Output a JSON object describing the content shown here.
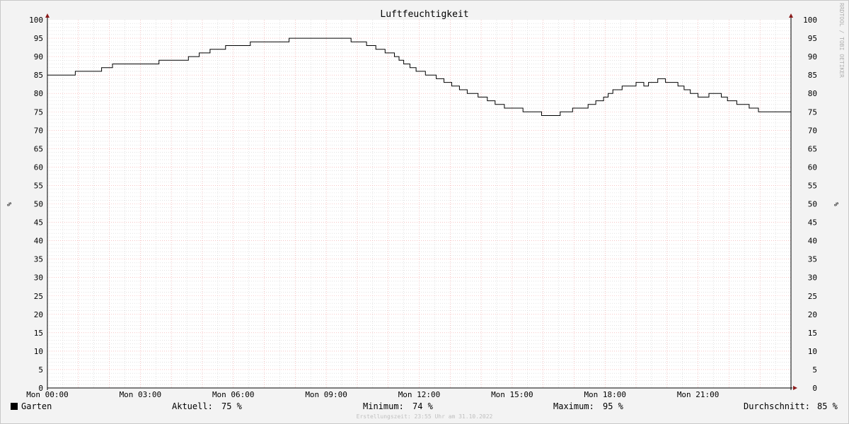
{
  "chart_data": {
    "type": "line",
    "title": "Luftfeuchtigkeit",
    "ylabel": "%",
    "ylim": [
      0,
      100
    ],
    "yticks": [
      0,
      5,
      10,
      15,
      20,
      25,
      30,
      35,
      40,
      45,
      50,
      55,
      60,
      65,
      70,
      75,
      80,
      85,
      90,
      95,
      100
    ],
    "xlim_hours": [
      0,
      24
    ],
    "xticks": [
      {
        "hour": 0,
        "label": "Mon 00:00"
      },
      {
        "hour": 3,
        "label": "Mon 03:00"
      },
      {
        "hour": 6,
        "label": "Mon 06:00"
      },
      {
        "hour": 9,
        "label": "Mon 09:00"
      },
      {
        "hour": 12,
        "label": "Mon 12:00"
      },
      {
        "hour": 15,
        "label": "Mon 15:00"
      },
      {
        "hour": 18,
        "label": "Mon 18:00"
      },
      {
        "hour": 21,
        "label": "Mon 21:00"
      }
    ],
    "grid": true,
    "series": [
      {
        "name": "Garten",
        "color": "#000000",
        "step": true,
        "points": [
          [
            0.0,
            85
          ],
          [
            0.9,
            86
          ],
          [
            1.75,
            87
          ],
          [
            2.1,
            88
          ],
          [
            3.6,
            89
          ],
          [
            4.55,
            90
          ],
          [
            4.9,
            91
          ],
          [
            5.25,
            92
          ],
          [
            5.75,
            93
          ],
          [
            6.55,
            94
          ],
          [
            7.8,
            95
          ],
          [
            9.8,
            94
          ],
          [
            10.3,
            93
          ],
          [
            10.6,
            92
          ],
          [
            10.9,
            91
          ],
          [
            11.2,
            90
          ],
          [
            11.35,
            89
          ],
          [
            11.5,
            88
          ],
          [
            11.7,
            87
          ],
          [
            11.9,
            86
          ],
          [
            12.2,
            85
          ],
          [
            12.55,
            84
          ],
          [
            12.8,
            83
          ],
          [
            13.05,
            82
          ],
          [
            13.3,
            81
          ],
          [
            13.55,
            80
          ],
          [
            13.9,
            79
          ],
          [
            14.2,
            78
          ],
          [
            14.45,
            77
          ],
          [
            14.75,
            76
          ],
          [
            15.35,
            75
          ],
          [
            15.95,
            74
          ],
          [
            16.55,
            75
          ],
          [
            16.95,
            76
          ],
          [
            17.45,
            77
          ],
          [
            17.7,
            78
          ],
          [
            17.95,
            79
          ],
          [
            18.1,
            80
          ],
          [
            18.25,
            81
          ],
          [
            18.55,
            82
          ],
          [
            19.0,
            83
          ],
          [
            19.25,
            82
          ],
          [
            19.4,
            83
          ],
          [
            19.7,
            84
          ],
          [
            19.95,
            83
          ],
          [
            20.35,
            82
          ],
          [
            20.55,
            81
          ],
          [
            20.75,
            80
          ],
          [
            21.0,
            79
          ],
          [
            21.35,
            80
          ],
          [
            21.75,
            79
          ],
          [
            21.95,
            78
          ],
          [
            22.25,
            77
          ],
          [
            22.65,
            76
          ],
          [
            22.95,
            75
          ],
          [
            24.0,
            75
          ]
        ]
      }
    ]
  },
  "legend": {
    "series_name": "Garten",
    "current_label": "Aktuell:",
    "current_value": "75 %",
    "min_label": "Minimum:",
    "min_value": "74 %",
    "max_label": "Maximum:",
    "max_value": "95 %",
    "avg_label": "Durchschnitt:",
    "avg_value": "85 %"
  },
  "watermark": "RRDTOOL / TOBI OETIKER",
  "footer": "Erstellungszeit: 23:55 Uhr am 31.10.2022",
  "colors": {
    "background": "#f3f3f3",
    "plot_background": "#ffffff",
    "major_grid": "#f2a0a0",
    "minor_grid": "#d0d0d0",
    "axis": "#000000",
    "arrow": "#8b1a1a",
    "line": "#000000"
  }
}
